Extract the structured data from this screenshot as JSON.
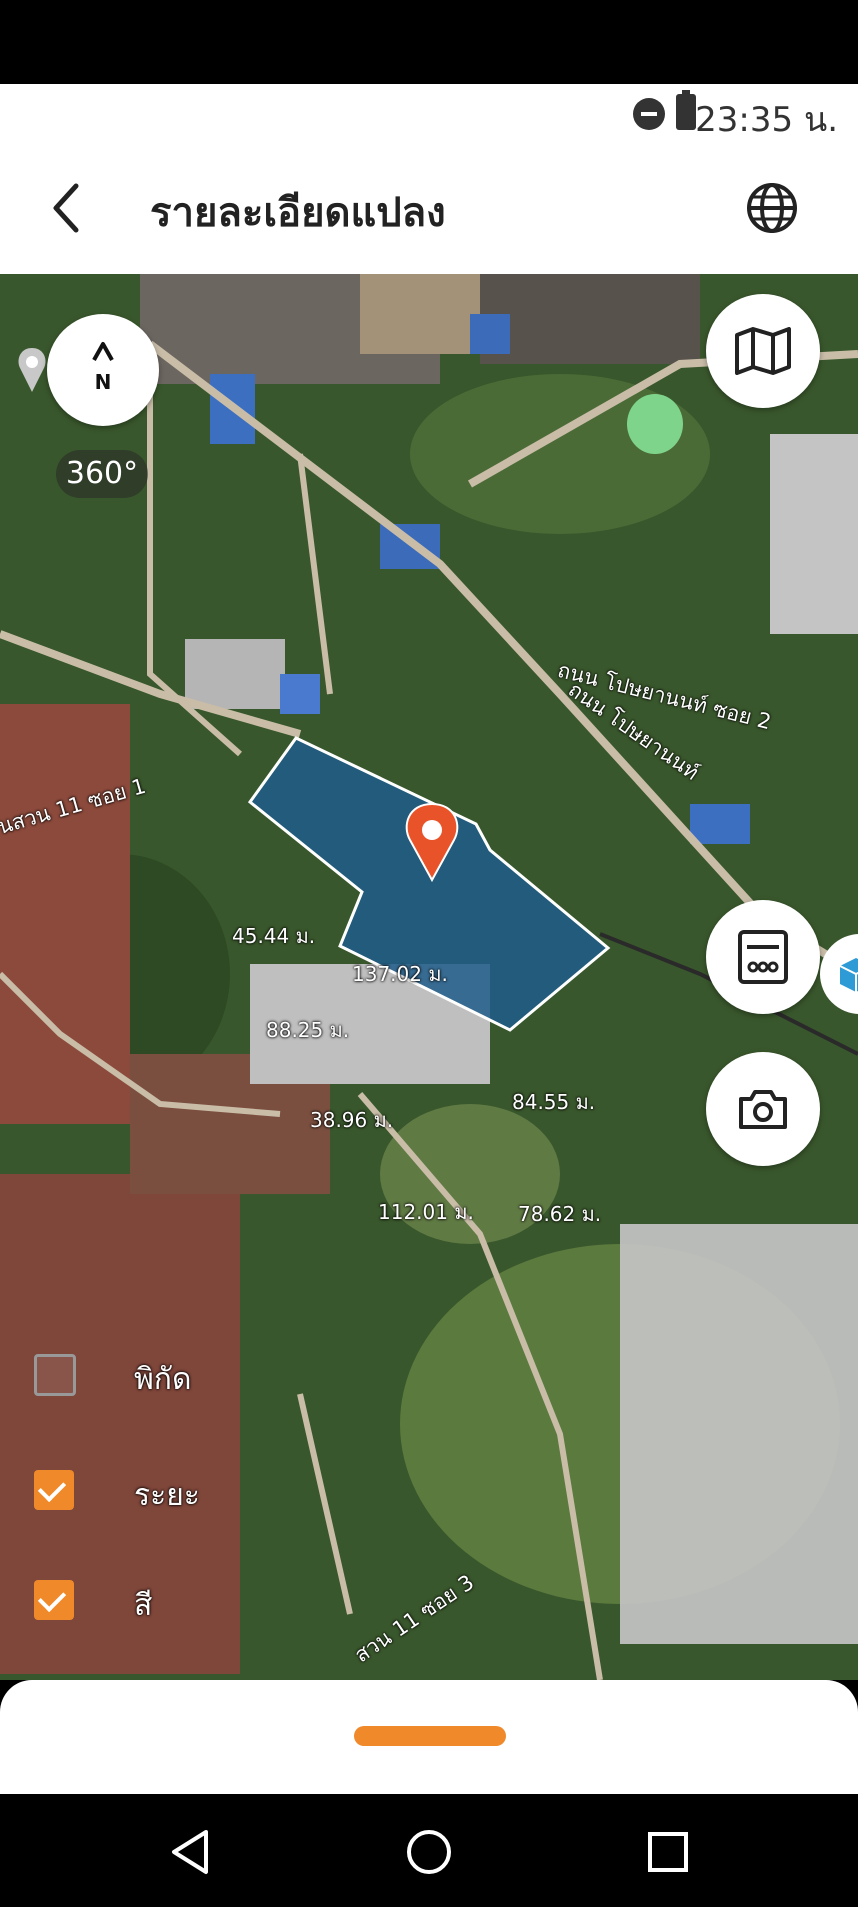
{
  "status_bar": {
    "time": "23:35 น."
  },
  "header": {
    "title": "รายละเอียดแปลง"
  },
  "map": {
    "compass_letter": "N",
    "rotation_label": "360°",
    "road_labels": [
      "ถนน โปษยานนท์ ซอย 2",
      "ถนน โปษยานนท์",
      "นสวน 11 ซอย 1",
      "สวน 11 ซอย 3"
    ],
    "measurements": [
      "45.44 ม.",
      "137.02 ม.",
      "88.25 ม.",
      "84.55 ม.",
      "38.96 ม.",
      "112.01 ม.",
      "78.62 ม."
    ],
    "layers": [
      {
        "label": "พิกัด",
        "checked": false
      },
      {
        "label": "ระยะ",
        "checked": true
      },
      {
        "label": "สี",
        "checked": true
      }
    ],
    "parcel_color": "#1f5c8a",
    "pin_color": "#e8532a"
  },
  "colors": {
    "accent": "#f0892a"
  }
}
